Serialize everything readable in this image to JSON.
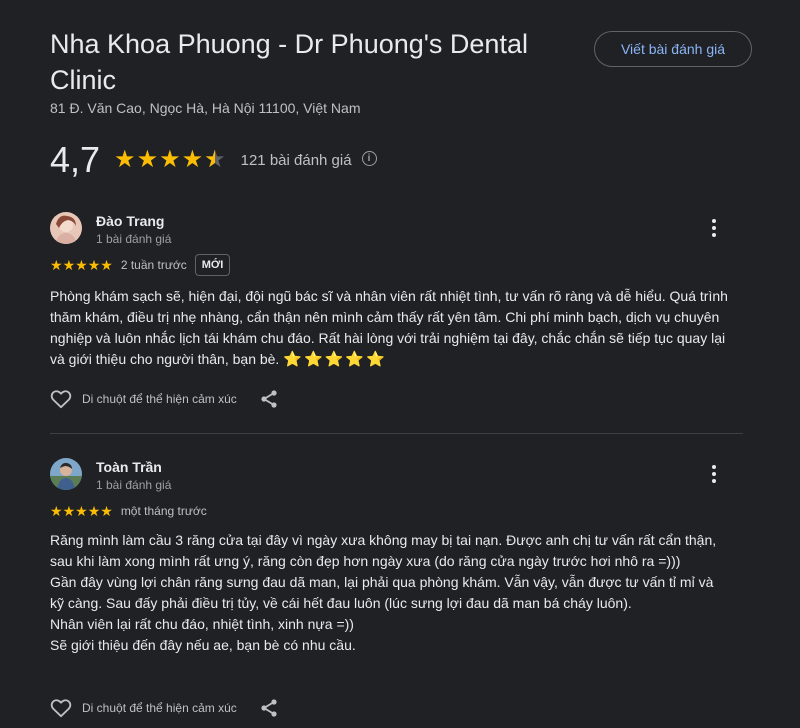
{
  "place": {
    "name": "Nha Khoa Phuong - Dr Phuong's Dental Clinic",
    "address": "81 Đ. Văn Cao, Ngọc Hà, Hà Nội 11100, Việt Nam",
    "rating": "4,7",
    "rating_stars": 4.7,
    "review_count": "121 bài đánh giá",
    "write_review_label": "Viết bài đánh giá"
  },
  "reviews": [
    {
      "name": "Đào Trang",
      "meta": "1 bài đánh giá",
      "stars": 5,
      "time": "2 tuần trước",
      "badge": "MỚI",
      "text": "Phòng khám sạch sẽ, hiện đại, đội ngũ bác sĩ và nhân viên rất nhiệt tình, tư vấn rõ ràng và dễ hiểu. Quá trình thăm khám, điều trị nhẹ nhàng, cẩn thận nên mình cảm thấy rất yên tâm. Chi phí minh bạch, dịch vụ chuyên nghiệp và luôn nhắc lịch tái khám chu đáo. Rất hài lòng với trải nghiệm tại đây, chắc chắn sẽ tiếp tục quay lại và giới thiệu cho người thân, bạn bè.",
      "emoji": "⭐⭐⭐⭐⭐",
      "react_label": "Di chuột để thể hiện cảm xúc"
    },
    {
      "name": "Toàn Trần",
      "meta": "1 bài đánh giá",
      "stars": 5,
      "time": "một tháng trước",
      "text_lines": [
        "Răng mình làm cầu 3 răng cửa tại đây vì ngày xưa không may bị tai nạn. Được anh chị tư vấn rất cẩn thận, sau khi làm xong mình rất ưng ý, răng còn đẹp hơn ngày xưa (do răng cửa ngày trước hơi nhô ra =)))",
        "Gần đây vùng lợi chân răng sưng đau dã man, lại phải qua phòng khám. Vẫn vậy, vẫn được tư vấn tỉ mỉ và kỹ càng. Sau đấy phải điều trị tủy, về cái hết đau luôn (lúc sưng lợi đau dã man bá cháy luôn).",
        "Nhân viên lại rất chu đáo, nhiệt tình, xinh nựa =))",
        "Sẽ giới thiệu đến đây nếu ae, bạn bè có nhu cầu."
      ],
      "react_label": "Di chuột để thể hiện cảm xúc"
    }
  ],
  "colors": {
    "star": "#fbbc04",
    "link": "#8ab4f8",
    "background": "#202124"
  }
}
